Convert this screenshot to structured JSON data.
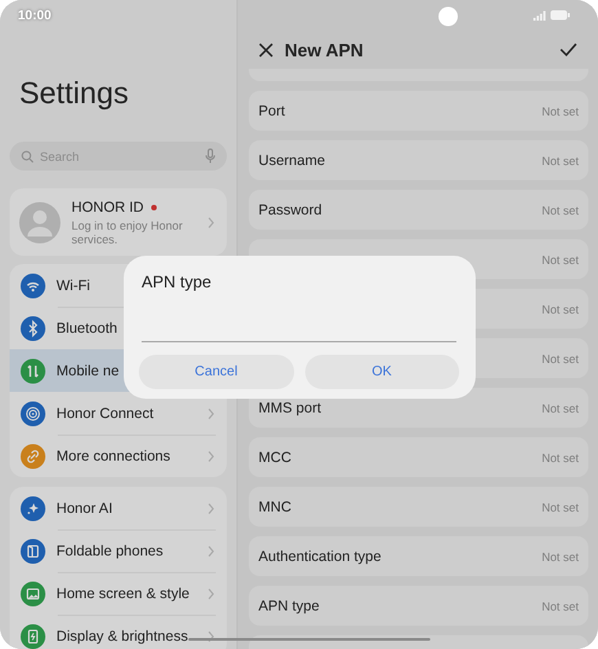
{
  "status_bar": {
    "time": "10:00"
  },
  "settings": {
    "title": "Settings",
    "search": {
      "placeholder": "Search"
    },
    "account": {
      "name": "HONOR ID",
      "notification_dot": true,
      "subtitle": "Log in to enjoy Honor services."
    },
    "groups": [
      {
        "items": [
          {
            "label": "Wi-Fi",
            "color": "#1f5fae",
            "selected": false
          },
          {
            "label": "Bluetooth",
            "color": "#1f5fae",
            "selected": false
          },
          {
            "label": "Mobile ne",
            "color": "#2b8f46",
            "selected": true
          },
          {
            "label": "Honor Connect",
            "color": "#1f5fae",
            "selected": false,
            "chevron": true
          },
          {
            "label": "More connections",
            "color": "#c9801c",
            "selected": false,
            "chevron": true
          }
        ]
      },
      {
        "items": [
          {
            "label": "Honor AI",
            "color": "#1f5fae",
            "selected": false,
            "chevron": true
          },
          {
            "label": "Foldable phones",
            "color": "#1f5fae",
            "selected": false,
            "chevron": true
          },
          {
            "label": "Home screen & style",
            "color": "#2b8f46",
            "selected": false,
            "chevron": true
          },
          {
            "label": "Display & brightness",
            "color": "#2b8f46",
            "selected": false,
            "chevron": true
          }
        ]
      }
    ]
  },
  "apn": {
    "title": "New APN",
    "rows": [
      {
        "label": "Port",
        "value": "Not set"
      },
      {
        "label": "Username",
        "value": "Not set"
      },
      {
        "label": "Password",
        "value": "Not set"
      },
      {
        "value": "Not set"
      },
      {
        "value": "Not set"
      },
      {
        "value": "Not set"
      },
      {
        "label": "MMS port",
        "value": "Not set"
      },
      {
        "label": "MCC",
        "value": "Not set"
      },
      {
        "label": "MNC",
        "value": "Not set"
      },
      {
        "label": "Authentication type",
        "value": "Not set"
      },
      {
        "label": "APN type",
        "value": "Not set"
      }
    ]
  },
  "dialog": {
    "title": "APN type",
    "buttons": [
      "Cancel",
      "OK"
    ]
  }
}
